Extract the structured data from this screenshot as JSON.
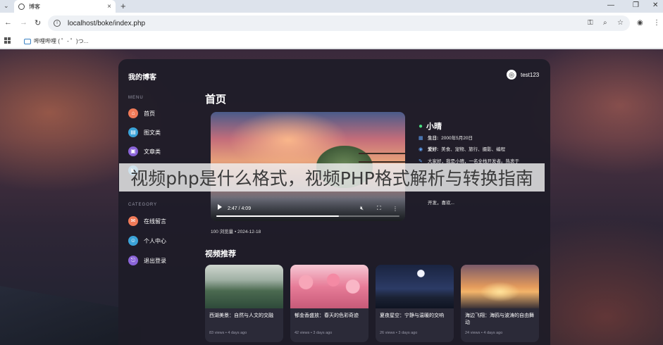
{
  "browser": {
    "tab_title": "博客",
    "tab_close": "×",
    "new_tab": "+",
    "url": "localhost/boke/index.php",
    "bookmark": "哔哩哔哩 ( ゜- ゜)つ..."
  },
  "site": {
    "logo": "我的博客",
    "user": "test123"
  },
  "sidebar": {
    "menu_head": "MENU",
    "menu": [
      {
        "label": "首页",
        "color": "#f07a58"
      },
      {
        "label": "图文类",
        "color": "#3ba3d8"
      },
      {
        "label": "文章类",
        "color": "#8a64d8"
      },
      {
        "label": "",
        "color": "#3ba3d8"
      }
    ],
    "category_head": "CATEGORY",
    "category": [
      {
        "label": "在线留言",
        "color": "#f07a58"
      },
      {
        "label": "个人中心",
        "color": "#3ba3d8"
      },
      {
        "label": "退出登录",
        "color": "#8a64d8"
      }
    ]
  },
  "main": {
    "title": "首页",
    "video": {
      "time": "2:47 / 4:09",
      "progress": 0.67
    },
    "meta": "100 浏览量 • 2024-12-18",
    "profile": {
      "name": "小晴",
      "birthday_label": "生日:",
      "birthday": "2000年5月20日",
      "hobby_label": "爱好:",
      "hobby": "美食、宠物、旅行、摄影、编程",
      "intro": "大家好，我是小晴，一名全栈开发者。热衷于",
      "intro2": "开发，喜欢..."
    },
    "rec_title": "视频推荐",
    "recommendations": [
      {
        "title": "西湖美景：自然与人文的交融",
        "meta": "83 views • 4 days ago"
      },
      {
        "title": "郁金香盛放：春天的色彩奇迹",
        "meta": "42 views • 3 days ago"
      },
      {
        "title": "夏夜星空：宁静与温暖的交响",
        "meta": "26 views • 3 days ago"
      },
      {
        "title": "海边飞翔：海鸥与波涛的自由舞动",
        "meta": "24 views • 4 days ago"
      }
    ]
  },
  "overlay_banner": "视频php是什么格式，视频PHP格式解析与转换指南"
}
